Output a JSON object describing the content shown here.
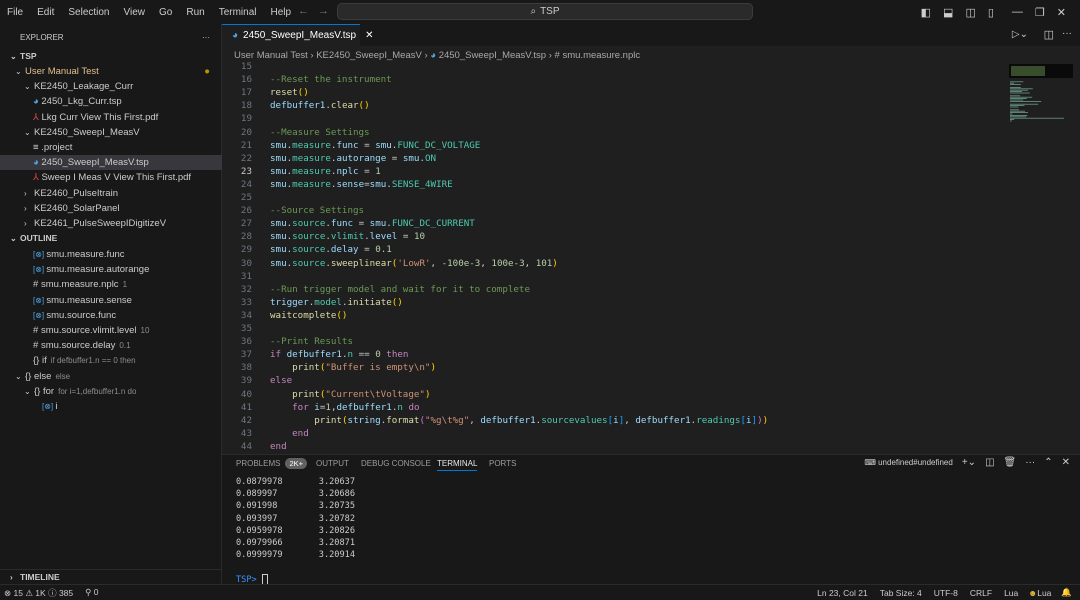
{
  "menu": [
    "File",
    "Edit",
    "Selection",
    "View",
    "Go",
    "Run",
    "Terminal",
    "Help"
  ],
  "search": "TSP",
  "explorer": {
    "title": "EXPLORER",
    "root": "TSP",
    "items": [
      {
        "label": "User Manual Test",
        "indent": 1,
        "chev": "down",
        "modified": true
      },
      {
        "label": "KE2450_Leakage_Curr",
        "indent": 2,
        "chev": "down"
      },
      {
        "label": "2450_Lkg_Curr.tsp",
        "indent": 3,
        "icon": "tsp"
      },
      {
        "label": "Lkg Curr View This First.pdf",
        "indent": 3,
        "icon": "pdf"
      },
      {
        "label": "KE2450_SweepI_MeasV",
        "indent": 2,
        "chev": "down"
      },
      {
        "label": ".project",
        "indent": 3,
        "icon": "file"
      },
      {
        "label": "2450_SweepI_MeasV.tsp",
        "indent": 3,
        "icon": "tsp",
        "selected": true
      },
      {
        "label": "Sweep I Meas V View This First.pdf",
        "indent": 3,
        "icon": "pdf"
      },
      {
        "label": "KE2460_PulseItrain",
        "indent": 2,
        "chev": "right"
      },
      {
        "label": "KE2460_SolarPanel",
        "indent": 2,
        "chev": "right"
      },
      {
        "label": "KE2461_PulseSweepIDigitizeV",
        "indent": 2,
        "chev": "right"
      }
    ]
  },
  "outline": {
    "title": "OUTLINE",
    "items": [
      {
        "label": "smu.measure.func",
        "icon": "var",
        "indent": 3
      },
      {
        "label": "smu.measure.autorange",
        "icon": "var",
        "indent": 3
      },
      {
        "label": "smu.measure.nplc",
        "icon": "num",
        "detail": "1",
        "indent": 3
      },
      {
        "label": "smu.measure.sense",
        "icon": "var",
        "indent": 3
      },
      {
        "label": "smu.source.func",
        "icon": "var",
        "indent": 3
      },
      {
        "label": "smu.source.vlimit.level",
        "icon": "num",
        "detail": "10",
        "indent": 3
      },
      {
        "label": "smu.source.delay",
        "icon": "num",
        "detail": "0.1",
        "indent": 3
      },
      {
        "label": "if",
        "icon": "brace",
        "detail": "if defbuffer1.n == 0 then",
        "indent": 3
      },
      {
        "label": "else",
        "icon": "brace",
        "detail": "else",
        "indent": 1,
        "chev": "down"
      },
      {
        "label": "for",
        "icon": "brace",
        "detail": "for i=1,defbuffer1.n do",
        "indent": 2,
        "chev": "down"
      },
      {
        "label": "i",
        "icon": "var",
        "indent": 4
      }
    ]
  },
  "timeline": "TIMELINE",
  "tab": {
    "label": "2450_SweepI_MeasV.tsp"
  },
  "breadcrumb": [
    "User Manual Test",
    "KE2450_SweepI_MeasV",
    "2450_SweepI_MeasV.tsp",
    "smu.measure.nplc"
  ],
  "code": {
    "first_line": 15,
    "current_line": 23,
    "lines": [
      [],
      [
        [
          "--Reset the instrument",
          "c"
        ]
      ],
      [
        [
          "reset",
          "f"
        ],
        [
          "()",
          "b"
        ]
      ],
      [
        [
          "defbuffer1",
          "v"
        ],
        [
          ".",
          ""
        ],
        [
          "clear",
          "f"
        ],
        [
          "()",
          "b"
        ]
      ],
      [],
      [
        [
          "--Measure Settings",
          "c"
        ]
      ],
      [
        [
          "smu",
          "v"
        ],
        [
          ".",
          ""
        ],
        [
          "measure",
          "p"
        ],
        [
          ".",
          ""
        ],
        [
          "func",
          "v"
        ],
        [
          " = ",
          ""
        ],
        [
          "smu",
          "v"
        ],
        [
          ".",
          ""
        ],
        [
          "FUNC_DC_VOLTAGE",
          "p"
        ]
      ],
      [
        [
          "smu",
          "v"
        ],
        [
          ".",
          ""
        ],
        [
          "measure",
          "p"
        ],
        [
          ".",
          ""
        ],
        [
          "autorange",
          "v"
        ],
        [
          " = ",
          ""
        ],
        [
          "smu",
          "v"
        ],
        [
          ".",
          ""
        ],
        [
          "ON",
          "p"
        ]
      ],
      [
        [
          "smu",
          "v"
        ],
        [
          ".",
          ""
        ],
        [
          "measure",
          "p"
        ],
        [
          ".",
          ""
        ],
        [
          "nplc",
          "v"
        ],
        [
          " = ",
          ""
        ],
        [
          "1",
          "n"
        ]
      ],
      [
        [
          "smu",
          "v"
        ],
        [
          ".",
          ""
        ],
        [
          "measure",
          "p"
        ],
        [
          ".",
          ""
        ],
        [
          "sense",
          "v"
        ],
        [
          "=",
          ""
        ],
        [
          "smu",
          "v"
        ],
        [
          ".",
          ""
        ],
        [
          "SENSE_4WIRE",
          "p"
        ]
      ],
      [],
      [
        [
          "--Source Settings",
          "c"
        ]
      ],
      [
        [
          "smu",
          "v"
        ],
        [
          ".",
          ""
        ],
        [
          "source",
          "p"
        ],
        [
          ".",
          ""
        ],
        [
          "func",
          "v"
        ],
        [
          " = ",
          ""
        ],
        [
          "smu",
          "v"
        ],
        [
          ".",
          ""
        ],
        [
          "FUNC_DC_CURRENT",
          "p"
        ]
      ],
      [
        [
          "smu",
          "v"
        ],
        [
          ".",
          ""
        ],
        [
          "source",
          "p"
        ],
        [
          ".",
          ""
        ],
        [
          "vlimit",
          "p"
        ],
        [
          ".",
          ""
        ],
        [
          "level",
          "v"
        ],
        [
          " = ",
          ""
        ],
        [
          "10",
          "n"
        ]
      ],
      [
        [
          "smu",
          "v"
        ],
        [
          ".",
          ""
        ],
        [
          "source",
          "p"
        ],
        [
          ".",
          ""
        ],
        [
          "delay",
          "v"
        ],
        [
          " = ",
          ""
        ],
        [
          "0.1",
          "n"
        ]
      ],
      [
        [
          "smu",
          "v"
        ],
        [
          ".",
          ""
        ],
        [
          "source",
          "p"
        ],
        [
          ".",
          ""
        ],
        [
          "sweeplinear",
          "f"
        ],
        [
          "(",
          "b"
        ],
        [
          "'LowR'",
          "s"
        ],
        [
          ", ",
          ""
        ],
        [
          "-100e-3",
          "n"
        ],
        [
          ", ",
          ""
        ],
        [
          "100e-3",
          "n"
        ],
        [
          ", ",
          ""
        ],
        [
          "101",
          "n"
        ],
        [
          ")",
          "b"
        ]
      ],
      [],
      [
        [
          "--Run trigger model and wait for it to complete",
          "c"
        ]
      ],
      [
        [
          "trigger",
          "v"
        ],
        [
          ".",
          ""
        ],
        [
          "model",
          "p"
        ],
        [
          ".",
          ""
        ],
        [
          "initiate",
          "f"
        ],
        [
          "()",
          "b"
        ]
      ],
      [
        [
          "waitcomplete",
          "f"
        ],
        [
          "()",
          "b"
        ]
      ],
      [],
      [
        [
          "--Print Results",
          "c"
        ]
      ],
      [
        [
          "if",
          "k"
        ],
        [
          " ",
          ""
        ],
        [
          "defbuffer1",
          "v"
        ],
        [
          ".",
          ""
        ],
        [
          "n",
          "p"
        ],
        [
          " == ",
          ""
        ],
        [
          "0",
          "n"
        ],
        [
          " ",
          ""
        ],
        [
          "then",
          "k"
        ]
      ],
      [
        [
          "    ",
          ""
        ],
        [
          "print",
          "f"
        ],
        [
          "(",
          "b"
        ],
        [
          "\"Buffer is empty\\n\"",
          "s"
        ],
        [
          ")",
          "b"
        ]
      ],
      [
        [
          "else",
          "k"
        ]
      ],
      [
        [
          "    ",
          ""
        ],
        [
          "print",
          "f"
        ],
        [
          "(",
          "b"
        ],
        [
          "\"Current\\tVoltage\"",
          "s"
        ],
        [
          ")",
          "b"
        ]
      ],
      [
        [
          "    ",
          ""
        ],
        [
          "for",
          "k"
        ],
        [
          " ",
          ""
        ],
        [
          "i",
          "v"
        ],
        [
          "=",
          ""
        ],
        [
          "1",
          "n"
        ],
        [
          ",",
          ""
        ],
        [
          "defbuffer1",
          "v"
        ],
        [
          ".",
          ""
        ],
        [
          "n",
          "p"
        ],
        [
          " ",
          ""
        ],
        [
          "do",
          "k"
        ]
      ],
      [
        [
          "        ",
          ""
        ],
        [
          "print",
          "f"
        ],
        [
          "(",
          "b"
        ],
        [
          "string",
          "v"
        ],
        [
          ".",
          ""
        ],
        [
          "format",
          "f"
        ],
        [
          "(",
          "b2"
        ],
        [
          "\"%g\\t%g\"",
          "s"
        ],
        [
          ", ",
          ""
        ],
        [
          "defbuffer1",
          "v"
        ],
        [
          ".",
          ""
        ],
        [
          "sourcevalues",
          "p"
        ],
        [
          "[",
          "b3"
        ],
        [
          "i",
          "v"
        ],
        [
          "]",
          "b3"
        ],
        [
          ", ",
          ""
        ],
        [
          "defbuffer1",
          "v"
        ],
        [
          ".",
          ""
        ],
        [
          "readings",
          "p"
        ],
        [
          "[",
          "b3"
        ],
        [
          "i",
          "v"
        ],
        [
          "]",
          "b3"
        ],
        [
          ")",
          "b2"
        ],
        [
          ")",
          "b"
        ]
      ],
      [
        [
          "    ",
          ""
        ],
        [
          "end",
          "k"
        ]
      ],
      [
        [
          "end",
          "k"
        ]
      ]
    ]
  },
  "panel": {
    "tabs": [
      "PROBLEMS",
      "OUTPUT",
      "DEBUG CONSOLE",
      "TERMINAL",
      "PORTS"
    ],
    "active": "TERMINAL",
    "problems_badge": "2K+",
    "terminal_name": "undefined#undefined",
    "terminal_lines": [
      "0.0879978       3.20637",
      "0.089997        3.20686",
      "0.091998        3.20735",
      "0.093997        3.20782",
      "0.0959978       3.20826",
      "0.0979966       3.20871",
      "0.0999979       3.20914"
    ],
    "prompt": "TSP>"
  },
  "status": {
    "errors": "15",
    "warnings": "1K",
    "info": "385",
    "ports": "0",
    "position": "Ln 23, Col 21",
    "tab_size": "Tab Size: 4",
    "encoding": "UTF-8",
    "eol": "CRLF",
    "language": "Lua",
    "lua_ext": "Lua"
  }
}
